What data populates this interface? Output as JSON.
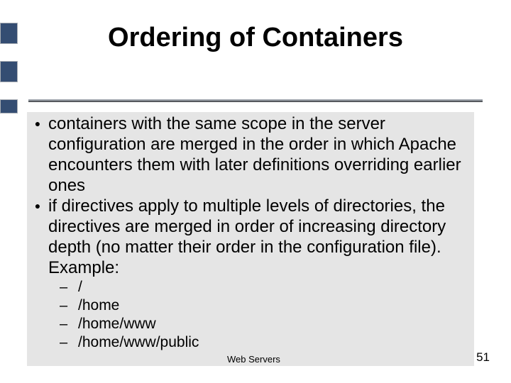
{
  "title": "Ordering of Containers",
  "bullets": [
    "containers with the same scope in the server configuration are merged in the order in which Apache encounters them with later definitions overriding earlier ones",
    "if directives apply to multiple levels of directories, the directives are merged in order of increasing directory depth (no matter their order in the configuration file).  Example:"
  ],
  "sub_bullets": [
    "/",
    "/home",
    "/home/www",
    "/home/www/public"
  ],
  "footer_label": "Web Servers",
  "page_number": "51"
}
